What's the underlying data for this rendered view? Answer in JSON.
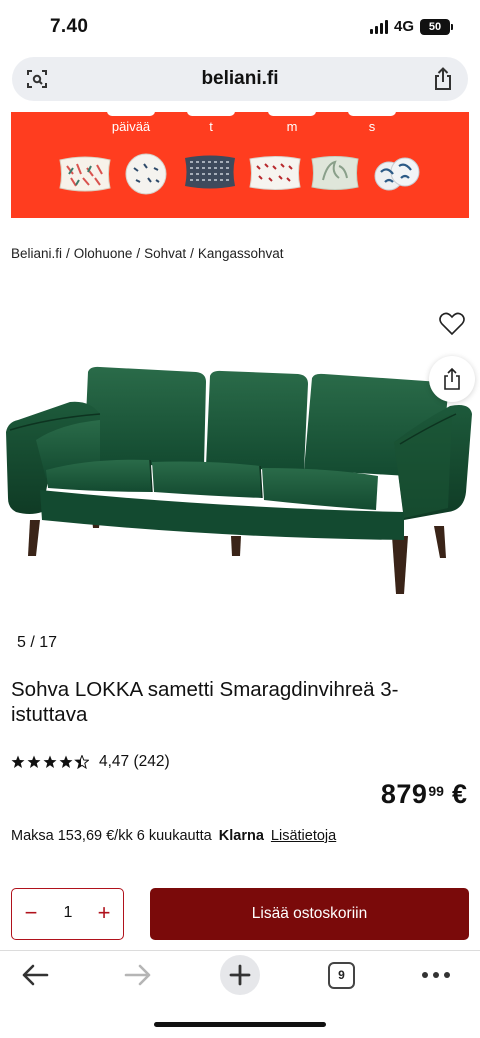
{
  "status_bar": {
    "time": "7.40",
    "network": "4G",
    "battery": "50"
  },
  "address_bar": {
    "url": "beliani.fi"
  },
  "promo": {
    "labels": [
      "päivää",
      "t",
      "m",
      "s"
    ]
  },
  "breadcrumb": [
    "Beliani.fi",
    "Olohuone",
    "Sohvat",
    "Kangassohvat"
  ],
  "gallery": {
    "counter": "5 / 17"
  },
  "product": {
    "title": "Sohva LOKKA sametti Smaragdinvihreä 3-istuttava",
    "rating": {
      "stars": 4.47,
      "text": "4,47 (242)"
    },
    "price": {
      "integer": "879",
      "decimals": "99",
      "currency": "€"
    },
    "financing": {
      "text": "Maksa 153,69 €/kk 6 kuukautta",
      "brand": "Klarna",
      "link": "Lisätietoja"
    }
  },
  "cart": {
    "quantity": "1",
    "minus": "−",
    "plus": "+",
    "add_label": "Lisää ostoskoriin"
  },
  "toolbar": {
    "tab_count": "9"
  },
  "colors": {
    "promo_bg": "#ff3d1f",
    "accent": "#b0121c",
    "cart_button": "#7a0a0a",
    "sofa": "#1f5a3c"
  }
}
